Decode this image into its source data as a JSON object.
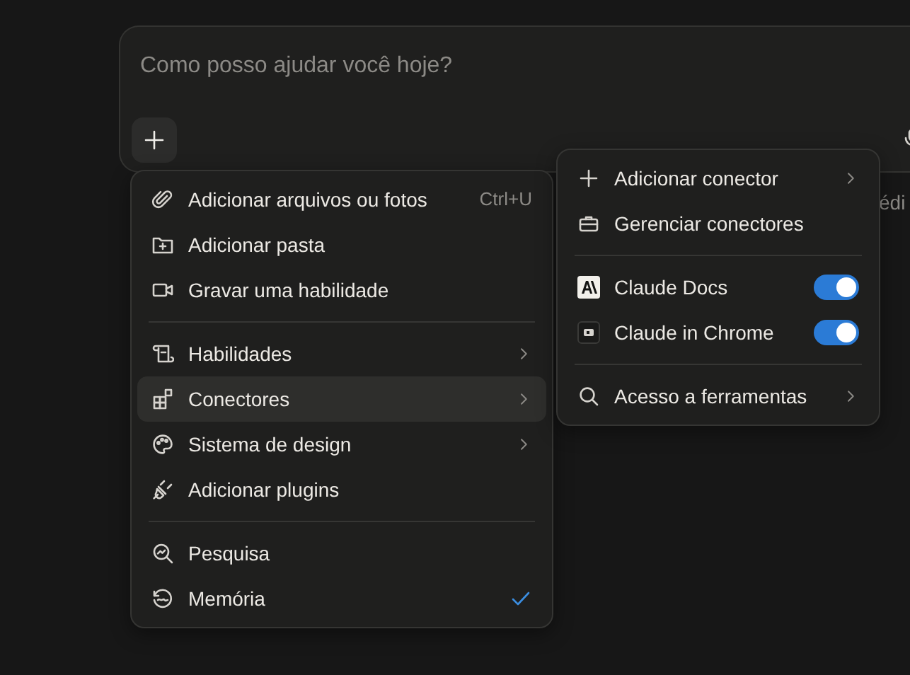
{
  "composer": {
    "placeholder": "Como posso ajudar você hoje?",
    "behind_text": "édi"
  },
  "menu": {
    "sections": [
      {
        "items": [
          {
            "label": "Adicionar arquivos ou fotos",
            "shortcut": "Ctrl+U",
            "has_submenu": false,
            "selected": false,
            "checked": false
          },
          {
            "label": "Adicionar pasta",
            "has_submenu": false,
            "selected": false,
            "checked": false
          },
          {
            "label": "Gravar uma habilidade",
            "has_submenu": false,
            "selected": false,
            "checked": false
          }
        ]
      },
      {
        "items": [
          {
            "label": "Habilidades",
            "has_submenu": true,
            "selected": false,
            "checked": false
          },
          {
            "label": "Conectores",
            "has_submenu": true,
            "selected": true,
            "checked": false
          },
          {
            "label": "Sistema de design",
            "has_submenu": true,
            "selected": false,
            "checked": false
          },
          {
            "label": "Adicionar plugins",
            "has_submenu": false,
            "selected": false,
            "checked": false
          }
        ]
      },
      {
        "items": [
          {
            "label": "Pesquisa",
            "has_submenu": false,
            "selected": false,
            "checked": false
          },
          {
            "label": "Memória",
            "has_submenu": false,
            "selected": false,
            "checked": true
          }
        ]
      }
    ]
  },
  "submenu": {
    "sections": [
      {
        "items": [
          {
            "kind": "action",
            "label": "Adicionar conector",
            "has_submenu": true
          },
          {
            "kind": "action",
            "label": "Gerenciar conectores",
            "has_submenu": false
          }
        ]
      },
      {
        "items": [
          {
            "kind": "toggle",
            "label": "Claude Docs",
            "on": true
          },
          {
            "kind": "toggle",
            "label": "Claude in Chrome",
            "on": true
          }
        ]
      },
      {
        "items": [
          {
            "kind": "action",
            "label": "Acesso a ferramentas",
            "has_submenu": true
          }
        ]
      }
    ]
  }
}
